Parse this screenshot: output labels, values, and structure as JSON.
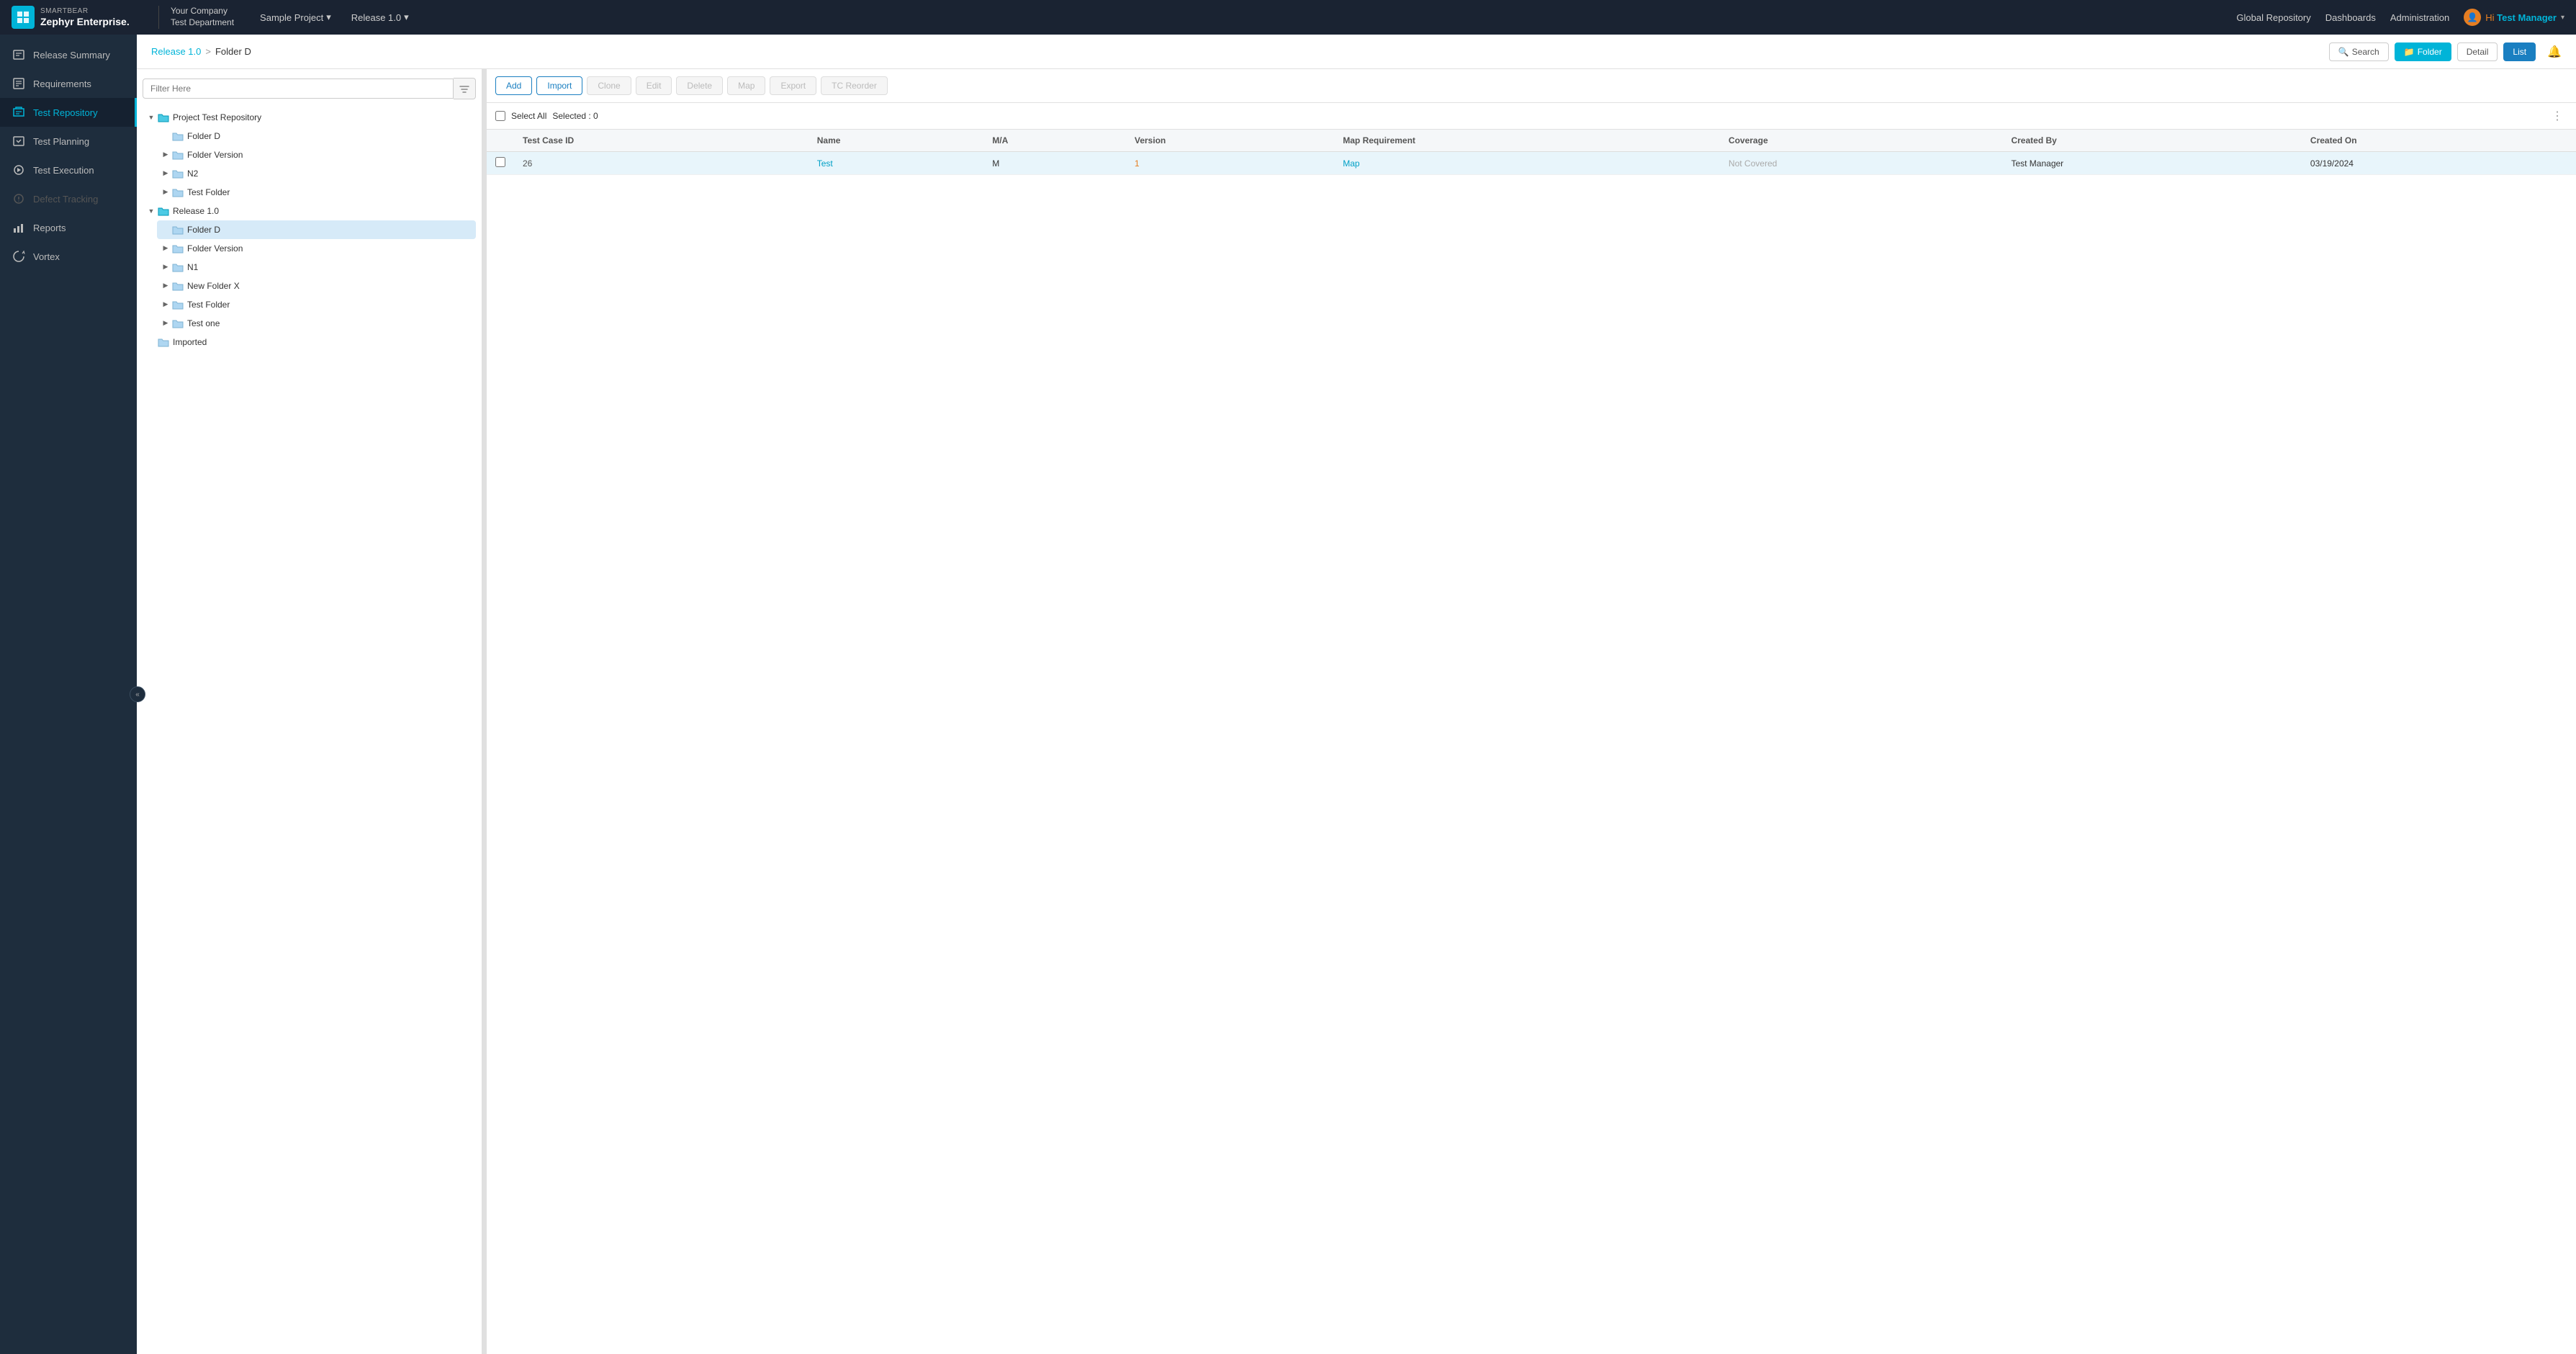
{
  "app": {
    "brand": "SMARTBEAR",
    "product": "Zephyr Enterprise.",
    "company": "Your Company",
    "department": "Test Department"
  },
  "topnav": {
    "project_label": "Sample Project",
    "project_arrow": "▾",
    "release_label": "Release 1.0",
    "release_arrow": "▾",
    "global_repository": "Global Repository",
    "dashboards": "Dashboards",
    "administration": "Administration",
    "hi_label": "Hi",
    "user_name": "Test Manager",
    "user_arrow": "▾"
  },
  "sidebar": {
    "collapse_icon": "«",
    "items": [
      {
        "id": "release-summary",
        "label": "Release Summary",
        "active": false,
        "disabled": false
      },
      {
        "id": "requirements",
        "label": "Requirements",
        "active": false,
        "disabled": false
      },
      {
        "id": "test-repository",
        "label": "Test Repository",
        "active": true,
        "disabled": false
      },
      {
        "id": "test-planning",
        "label": "Test Planning",
        "active": false,
        "disabled": false
      },
      {
        "id": "test-execution",
        "label": "Test Execution",
        "active": false,
        "disabled": false
      },
      {
        "id": "defect-tracking",
        "label": "Defect Tracking",
        "active": false,
        "disabled": true
      },
      {
        "id": "reports",
        "label": "Reports",
        "active": false,
        "disabled": false
      },
      {
        "id": "vortex",
        "label": "Vortex",
        "active": false,
        "disabled": false
      }
    ]
  },
  "breadcrumb": {
    "link": "Release 1.0",
    "separator": ">",
    "current": "Folder D"
  },
  "toolbar_actions": {
    "search": "Search",
    "folder": "Folder",
    "detail": "Detail",
    "list": "List"
  },
  "action_buttons": {
    "add": "Add",
    "import": "Import",
    "clone": "Clone",
    "edit": "Edit",
    "delete": "Delete",
    "map": "Map",
    "export": "Export",
    "tc_reorder": "TC Reorder"
  },
  "select_bar": {
    "select_all": "Select All",
    "selected_label": "Selected : 0"
  },
  "table": {
    "columns": [
      {
        "id": "test-case-id",
        "label": "Test Case ID"
      },
      {
        "id": "name",
        "label": "Name"
      },
      {
        "id": "ma",
        "label": "M/A"
      },
      {
        "id": "version",
        "label": "Version"
      },
      {
        "id": "map-requirement",
        "label": "Map Requirement"
      },
      {
        "id": "coverage",
        "label": "Coverage"
      },
      {
        "id": "created-by",
        "label": "Created By"
      },
      {
        "id": "created-on",
        "label": "Created On"
      }
    ],
    "rows": [
      {
        "id": "26",
        "name": "Test",
        "ma": "M",
        "version": "1",
        "map_requirement": "Map",
        "coverage": "Not Covered",
        "created_by": "Test Manager",
        "created_on": "03/19/2024",
        "highlighted": true
      }
    ]
  },
  "filter": {
    "placeholder": "Filter Here"
  },
  "tree": {
    "nodes": [
      {
        "id": "project-test-repo",
        "label": "Project Test Repository",
        "type": "root-folder",
        "open": true,
        "selected": false,
        "children": [
          {
            "id": "folder-d-proj",
            "label": "Folder D",
            "type": "folder",
            "open": false,
            "selected": false,
            "children": []
          },
          {
            "id": "folder-version-proj",
            "label": "Folder Version",
            "type": "folder",
            "open": false,
            "selected": false,
            "children": []
          },
          {
            "id": "n2-proj",
            "label": "N2",
            "type": "folder",
            "open": false,
            "selected": false,
            "children": []
          },
          {
            "id": "test-folder-proj",
            "label": "Test Folder",
            "type": "folder",
            "open": false,
            "selected": false,
            "children": []
          }
        ]
      },
      {
        "id": "release-1",
        "label": "Release 1.0",
        "type": "root-folder-blue",
        "open": true,
        "selected": false,
        "children": [
          {
            "id": "folder-d-rel",
            "label": "Folder D",
            "type": "folder",
            "open": false,
            "selected": true,
            "children": []
          },
          {
            "id": "folder-version-rel",
            "label": "Folder Version",
            "type": "folder",
            "open": false,
            "selected": false,
            "children": []
          },
          {
            "id": "n1-rel",
            "label": "N1",
            "type": "folder",
            "open": false,
            "selected": false,
            "children": []
          },
          {
            "id": "new-folder-x",
            "label": "New Folder X",
            "type": "folder",
            "open": false,
            "selected": false,
            "children": []
          },
          {
            "id": "test-folder-rel",
            "label": "Test Folder",
            "type": "folder",
            "open": false,
            "selected": false,
            "children": []
          },
          {
            "id": "test-one",
            "label": "Test one",
            "type": "folder",
            "open": false,
            "selected": false,
            "children": []
          }
        ]
      },
      {
        "id": "imported",
        "label": "Imported",
        "type": "folder-plain",
        "open": false,
        "selected": false,
        "children": []
      }
    ]
  }
}
